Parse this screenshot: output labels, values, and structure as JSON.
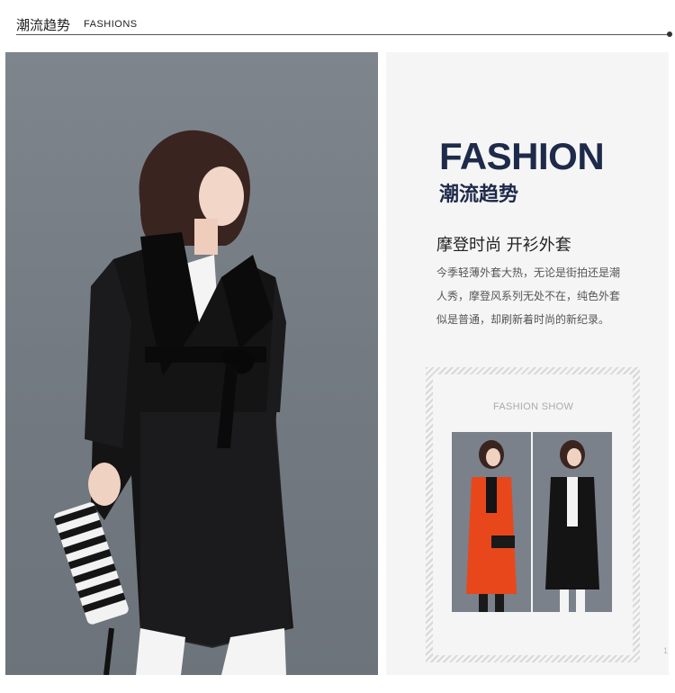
{
  "header": {
    "title_cn": "潮流趋势",
    "title_en": "FASHIONS"
  },
  "panel": {
    "headline": "FASHION",
    "headline_cn": "潮流趋势",
    "subtitle": "摩登时尚 开衫外套",
    "description_lines": [
      "今季轻薄外套大热，无论是街拍还是潮",
      "人秀，摩登风系列无处不在，纯色外套",
      "似是普通，却刷新着时尚的新纪录。"
    ]
  },
  "show": {
    "label": "FASHION SHOW"
  },
  "page_number": "1",
  "colors": {
    "headline": "#1e2a4a",
    "coat_black": "#141414",
    "coat_orange": "#e8471c",
    "backdrop": "#757c84"
  }
}
